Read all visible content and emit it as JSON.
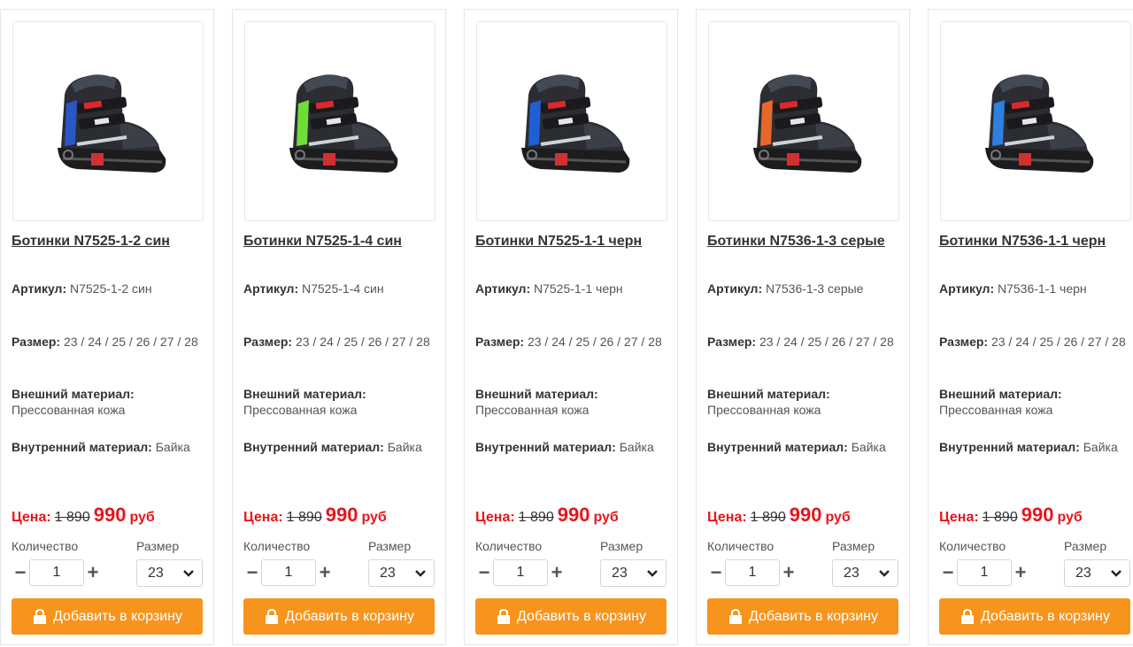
{
  "labels": {
    "article": "Артикул:",
    "size": "Размер:",
    "outer": "Внешний материал:",
    "inner": "Внутренний материал:",
    "price": "Цена:",
    "currency": "руб",
    "qty_label": "Количество",
    "size_label": "Размер",
    "cart_button": "Добавить в корзину"
  },
  "colors": {
    "accent": "#f7941d",
    "price_red": "#e8151b"
  },
  "products": [
    {
      "title": "Ботинки N7525-1-2 син",
      "article": "N7525-1-2 син",
      "sizes": "23 / 24 / 25 / 26 / 27 / 28",
      "outer": "Прессованная кожа",
      "inner": "Байка",
      "old_price": "1 890",
      "new_price": "990",
      "qty": "1",
      "size_selected": "23",
      "accent": "#2a56c6"
    },
    {
      "title": "Ботинки N7525-1-4 син",
      "article": "N7525-1-4 син",
      "sizes": "23 / 24 / 25 / 26 / 27 / 28",
      "outer": "Прессованная кожа",
      "inner": "Байка",
      "old_price": "1 890",
      "new_price": "990",
      "qty": "1",
      "size_selected": "23",
      "accent": "#6fdc3a"
    },
    {
      "title": "Ботинки N7525-1-1 черн",
      "article": "N7525-1-1 черн",
      "sizes": "23 / 24 / 25 / 26 / 27 / 28",
      "outer": "Прессованная кожа",
      "inner": "Байка",
      "old_price": "1 890",
      "new_price": "990",
      "qty": "1",
      "size_selected": "23",
      "accent": "#1f5fd6"
    },
    {
      "title": "Ботинки N7536-1-3 серые",
      "article": "N7536-1-3 серые",
      "sizes": "23 / 24 / 25 / 26 / 27 / 28",
      "outer": "Прессованная кожа",
      "inner": "Байка",
      "old_price": "1 890",
      "new_price": "990",
      "qty": "1",
      "size_selected": "23",
      "accent": "#e8672a"
    },
    {
      "title": "Ботинки N7536-1-1 черн",
      "article": "N7536-1-1 черн",
      "sizes": "23 / 24 / 25 / 26 / 27 / 28",
      "outer": "Прессованная кожа",
      "inner": "Байка",
      "old_price": "1 890",
      "new_price": "990",
      "qty": "1",
      "size_selected": "23",
      "accent": "#2e7fe0"
    }
  ]
}
